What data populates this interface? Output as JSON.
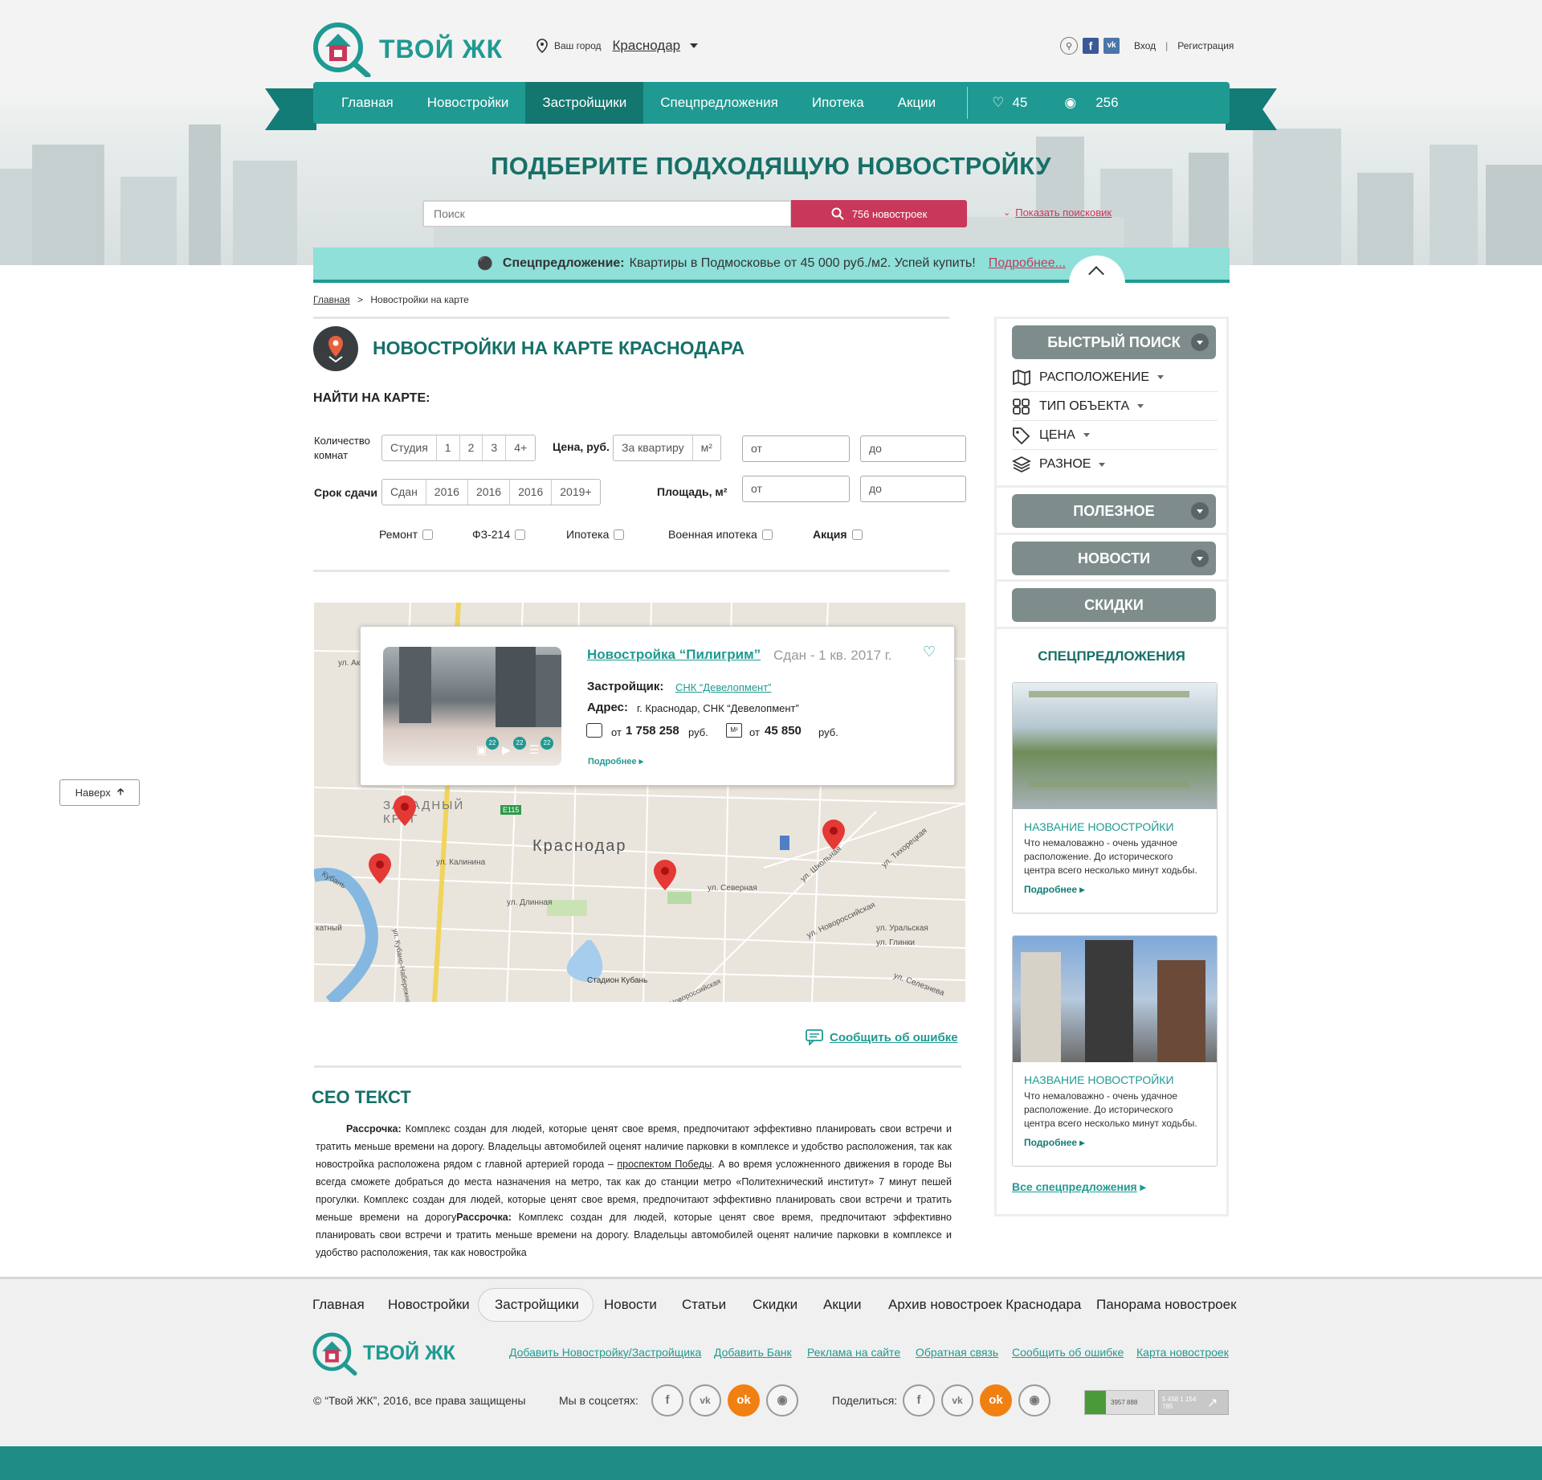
{
  "header": {
    "logo_text": "ТВОЙ ЖК",
    "city_label": "Ваш город",
    "city": "Краснодар",
    "login": "Вход",
    "separator": "|",
    "register": "Регистрация"
  },
  "nav": {
    "items": [
      "Главная",
      "Новостройки",
      "Застройщики",
      "Спецпредложения",
      "Ипотека",
      "Акции"
    ],
    "active": 2,
    "favorites": "45",
    "views": "256"
  },
  "hero": {
    "title": "ПОДБЕРИТЕ ПОДХОДЯЩУЮ НОВОСТРОЙКУ",
    "search_placeholder": "Поиск",
    "search_button": "756 новостроек",
    "show_search": "Показать поисковик"
  },
  "special": {
    "label": "Спецпредложение:",
    "text": "Квартиры в Подмосковье от 45 000 руб./м2. Успей купить!",
    "more": "Подробнее..."
  },
  "breadcrumb": {
    "home": "Главная",
    "sep": ">",
    "current": "Новостройки на карте"
  },
  "page_title": "НОВОСТРОЙКИ НА КАРТЕ КРАСНОДАРА",
  "filter": {
    "heading": "НАЙТИ НА КАРТЕ:",
    "rooms_label": "Количество комнат",
    "rooms": [
      "Студия",
      "1",
      "2",
      "3",
      "4+"
    ],
    "price_label": "Цена, руб.",
    "price_opts": [
      "За квартиру",
      "м²"
    ],
    "from": "от",
    "to": "до",
    "term_label": "Срок сдачи",
    "terms": [
      "Сдан",
      "2016",
      "2016",
      "2016",
      "2019+"
    ],
    "area_label": "Площадь, м²",
    "checks": [
      "Ремонт",
      "ФЗ-214",
      "Ипотека",
      "Военная ипотека",
      "Акция"
    ]
  },
  "map": {
    "city": "Краснодар",
    "district": "ЗАПАДНЫЙ КРУГ",
    "road": "E115",
    "streets": [
      "ул. Калинина",
      "ул. Длинная",
      "ул. Северная",
      "ул. Школьная",
      "ул. Тихорецкая",
      "ул. Новороссийская",
      "ул. Уральская",
      "ул. Глинки",
      "ул. Селезнева",
      "Стадион Кубань",
      "Кубань",
      "ул. Кубано-Набережная",
      "ул. Ак",
      "катный",
      "Новороссийская"
    ],
    "card": {
      "title": "Новостройка “Пилигрим”",
      "status": "Сдан - 1 кв. 2017 г.",
      "dev_label": "Застройщик:",
      "dev": "СНК “Девелопмент”",
      "addr_label": "Адрес:",
      "addr": "г. Краснодар, СНК “Девелопмент”",
      "price_from": "от",
      "price": "1 758 258",
      "price_unit": "руб.",
      "sqm_from": "от",
      "sqm": "45 850",
      "sqm_unit": "руб.",
      "more": "Подробнее",
      "photos": "22",
      "videos": "22",
      "comments": "22"
    }
  },
  "report_error": "Сообщить об ошибке",
  "seo": {
    "title": "СЕО ТЕКСТ",
    "lead": "Рассрочка:",
    "p1": " Комплекс создан для людей, которые ценят свое время, предпочитают эффективно планировать свои встречи и тратить меньше времени на дорогу. Владельцы автомобилей оценят наличие парковки в комплексе и удобство расположения, так как новостройка расположена рядом с главной артерией города – ",
    "link": "проспектом Победы",
    "p2": ". А во время усложненного движения в городе Вы всегда сможете добраться до места назначения на метро, так как до станции метро «Политехнический институт» 7 минут пешей прогулки. Комплекс создан для людей, которые ценят свое время, предпочитают эффективно планировать свои встречи и тратить меньше времени на дорогу",
    "lead2": "Рассрочка:",
    "p3": " Комплекс создан для людей, которые ценят свое время, предпочитают эффективно планировать свои встречи и тратить меньше времени на дорогу. Владельцы автомобилей оценят наличие парковки в комплексе и удобство расположения, так как новостройка"
  },
  "sidebar": {
    "quick": "БЫСТРЫЙ ПОИСК",
    "rows": [
      "РАСПОЛОЖЕНИЕ",
      "ТИП ОБЪЕКТА",
      "ЦЕНА",
      "РАЗНОЕ"
    ],
    "useful": "ПОЛЕЗНОЕ",
    "news": "НОВОСТИ",
    "discounts": "СКИДКИ",
    "specials_title": "СПЕЦПРЕДЛОЖЕНИЯ",
    "cards": [
      {
        "title": "НАЗВАНИЕ НОВОСТРОЙКИ",
        "text": "Что немаловажно - очень удачное расположение. До исторического центра всего несколько минут ходьбы.",
        "more": "Подробнее"
      },
      {
        "title": "НАЗВАНИЕ НОВОСТРОЙКИ",
        "text": "Что немаловажно - очень удачное расположение. До исторического центра всего несколько минут ходьбы.",
        "more": "Подробнее"
      }
    ],
    "all": "Все спецпредложения"
  },
  "to_top": "Наверх",
  "footer": {
    "nav": [
      "Главная",
      "Новостройки",
      "Застройщики",
      "Новости",
      "Статьи",
      "Скидки",
      "Акции",
      "Архив новостроек Краснодара",
      "Панорама новостроек"
    ],
    "active": 2,
    "links": [
      "Добавить Новостройку/Застройщика",
      "Добавить Банк",
      "Реклама на сайте",
      "Обратная связь",
      "Сообщить об ошибке",
      "Карта новостроек"
    ],
    "copyright": "© “Твой ЖК”, 2016, все права защищены",
    "social_label": "Мы в соцсетях:",
    "share_label": "Поделиться:",
    "counter1": "3957 888",
    "counter2": "5 458 1 154 785"
  },
  "colors": {
    "teal": "#1f9a92",
    "dark_teal": "#137c76",
    "accent_red": "#c9385a",
    "special_bg": "#8ee0d9",
    "pill_gray": "#7e8c8c"
  }
}
